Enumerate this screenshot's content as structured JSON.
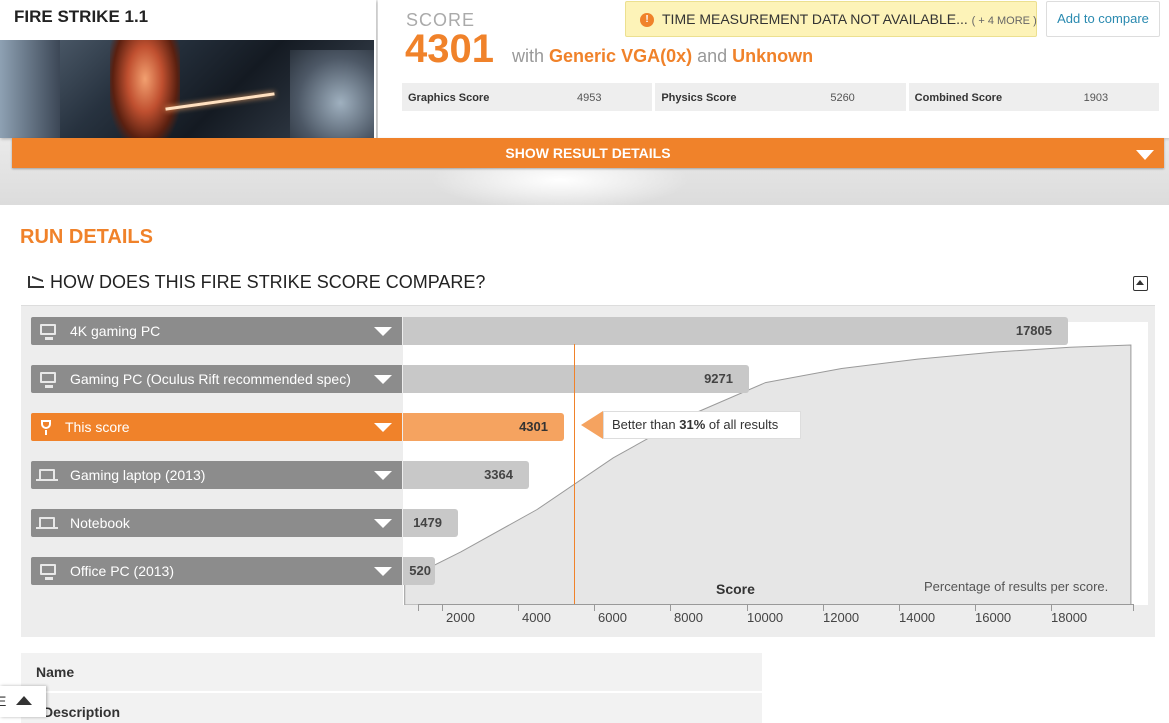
{
  "header": {
    "test_title": "FIRE STRIKE 1.1",
    "score_label": "SCORE",
    "score_value": "4301",
    "with_text": "with",
    "gpu": "Generic VGA(0x)",
    "and_text": "and",
    "cpu": "Unknown",
    "warning_text": "TIME MEASUREMENT DATA NOT AVAILABLE...",
    "warning_more": "( + 4 MORE )",
    "compare_button": "Add to compare",
    "subscores": [
      {
        "name": "Graphics Score",
        "value": "4953"
      },
      {
        "name": "Physics Score",
        "value": "5260"
      },
      {
        "name": "Combined Score",
        "value": "1903"
      }
    ],
    "show_details": "SHOW RESULT DETAILS"
  },
  "run_details": {
    "title": "RUN DETAILS",
    "compare_title": "HOW DOES THIS FIRE STRIKE SCORE COMPARE?",
    "tooltip_prefix": "Better than",
    "tooltip_pct": "31%",
    "tooltip_suffix": "of all results",
    "axis_label": "Score",
    "percentage_label": "Percentage of results per score.",
    "table_name": "Name",
    "table_description": "Description",
    "scroll_tab_text": "E"
  },
  "chart_data": {
    "type": "bar",
    "orientation": "horizontal",
    "categories": [
      "4K gaming PC",
      "Gaming PC (Oculus Rift recommended spec)",
      "This score",
      "Gaming laptop (2013)",
      "Notebook",
      "Office PC (2013)"
    ],
    "values": [
      17805,
      9271,
      4301,
      3364,
      1479,
      520
    ],
    "highlight": "This score",
    "x_ticks": [
      2000,
      4000,
      6000,
      8000,
      10000,
      12000,
      14000,
      16000,
      18000
    ],
    "x_tick_labels": [
      "2000",
      "4000",
      "6000",
      "8000",
      "10000",
      "12000",
      "14000",
      "16000",
      "18000"
    ],
    "xlabel": "Score",
    "xlim": [
      0,
      19800
    ],
    "highlight_color": "#f0822a",
    "bar_color": "#c8c8c8",
    "distribution": {
      "type": "area",
      "x": [
        520,
        2000,
        4000,
        6000,
        8000,
        10000,
        12000,
        14000,
        16000,
        18000,
        19600
      ],
      "y": [
        0.0,
        0.12,
        0.3,
        0.52,
        0.7,
        0.84,
        0.9,
        0.94,
        0.97,
        0.99,
        1.0
      ]
    }
  }
}
